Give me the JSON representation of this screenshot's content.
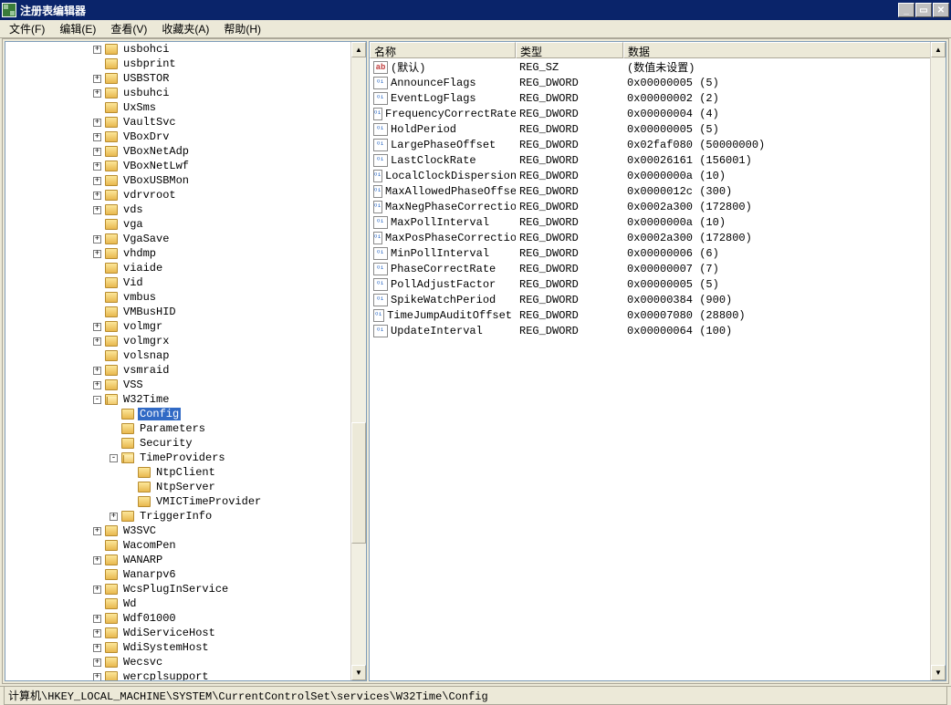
{
  "window": {
    "title": "注册表编辑器"
  },
  "menu": {
    "file": "文件(F)",
    "edit": "编辑(E)",
    "view": "查看(V)",
    "favorites": "收藏夹(A)",
    "help": "帮助(H)"
  },
  "tree": {
    "items": [
      {
        "indent": 5,
        "exp": "+",
        "label": "usbohci"
      },
      {
        "indent": 5,
        "exp": "",
        "label": "usbprint"
      },
      {
        "indent": 5,
        "exp": "+",
        "label": "USBSTOR"
      },
      {
        "indent": 5,
        "exp": "+",
        "label": "usbuhci"
      },
      {
        "indent": 5,
        "exp": "",
        "label": "UxSms"
      },
      {
        "indent": 5,
        "exp": "+",
        "label": "VaultSvc"
      },
      {
        "indent": 5,
        "exp": "+",
        "label": "VBoxDrv"
      },
      {
        "indent": 5,
        "exp": "+",
        "label": "VBoxNetAdp"
      },
      {
        "indent": 5,
        "exp": "+",
        "label": "VBoxNetLwf"
      },
      {
        "indent": 5,
        "exp": "+",
        "label": "VBoxUSBMon"
      },
      {
        "indent": 5,
        "exp": "+",
        "label": "vdrvroot"
      },
      {
        "indent": 5,
        "exp": "+",
        "label": "vds"
      },
      {
        "indent": 5,
        "exp": "",
        "label": "vga"
      },
      {
        "indent": 5,
        "exp": "+",
        "label": "VgaSave"
      },
      {
        "indent": 5,
        "exp": "+",
        "label": "vhdmp"
      },
      {
        "indent": 5,
        "exp": "",
        "label": "viaide"
      },
      {
        "indent": 5,
        "exp": "",
        "label": "Vid"
      },
      {
        "indent": 5,
        "exp": "",
        "label": "vmbus"
      },
      {
        "indent": 5,
        "exp": "",
        "label": "VMBusHID"
      },
      {
        "indent": 5,
        "exp": "+",
        "label": "volmgr"
      },
      {
        "indent": 5,
        "exp": "+",
        "label": "volmgrx"
      },
      {
        "indent": 5,
        "exp": "",
        "label": "volsnap"
      },
      {
        "indent": 5,
        "exp": "+",
        "label": "vsmraid"
      },
      {
        "indent": 5,
        "exp": "+",
        "label": "VSS"
      },
      {
        "indent": 5,
        "exp": "-",
        "label": "W32Time",
        "open": true
      },
      {
        "indent": 6,
        "exp": "",
        "label": "Config",
        "selected": true
      },
      {
        "indent": 6,
        "exp": "",
        "label": "Parameters"
      },
      {
        "indent": 6,
        "exp": "",
        "label": "Security"
      },
      {
        "indent": 6,
        "exp": "-",
        "label": "TimeProviders",
        "open": true
      },
      {
        "indent": 7,
        "exp": "",
        "label": "NtpClient"
      },
      {
        "indent": 7,
        "exp": "",
        "label": "NtpServer"
      },
      {
        "indent": 7,
        "exp": "",
        "label": "VMICTimeProvider"
      },
      {
        "indent": 6,
        "exp": "+",
        "label": "TriggerInfo"
      },
      {
        "indent": 5,
        "exp": "+",
        "label": "W3SVC"
      },
      {
        "indent": 5,
        "exp": "",
        "label": "WacomPen"
      },
      {
        "indent": 5,
        "exp": "+",
        "label": "WANARP"
      },
      {
        "indent": 5,
        "exp": "",
        "label": "Wanarpv6"
      },
      {
        "indent": 5,
        "exp": "+",
        "label": "WcsPlugInService"
      },
      {
        "indent": 5,
        "exp": "",
        "label": "Wd"
      },
      {
        "indent": 5,
        "exp": "+",
        "label": "Wdf01000"
      },
      {
        "indent": 5,
        "exp": "+",
        "label": "WdiServiceHost"
      },
      {
        "indent": 5,
        "exp": "+",
        "label": "WdiSystemHost"
      },
      {
        "indent": 5,
        "exp": "+",
        "label": "Wecsvc"
      },
      {
        "indent": 5,
        "exp": "+",
        "label": "wercplsupport"
      }
    ]
  },
  "list": {
    "headers": {
      "name": "名称",
      "type": "类型",
      "data": "数据"
    },
    "rows": [
      {
        "icon": "str",
        "name": "(默认)",
        "type": "REG_SZ",
        "data": "(数值未设置)"
      },
      {
        "icon": "dw",
        "name": "AnnounceFlags",
        "type": "REG_DWORD",
        "data": "0x00000005 (5)",
        "highlight": true
      },
      {
        "icon": "dw",
        "name": "EventLogFlags",
        "type": "REG_DWORD",
        "data": "0x00000002 (2)"
      },
      {
        "icon": "dw",
        "name": "FrequencyCorrectRate",
        "type": "REG_DWORD",
        "data": "0x00000004 (4)"
      },
      {
        "icon": "dw",
        "name": "HoldPeriod",
        "type": "REG_DWORD",
        "data": "0x00000005 (5)"
      },
      {
        "icon": "dw",
        "name": "LargePhaseOffset",
        "type": "REG_DWORD",
        "data": "0x02faf080 (50000000)"
      },
      {
        "icon": "dw",
        "name": "LastClockRate",
        "type": "REG_DWORD",
        "data": "0x00026161 (156001)"
      },
      {
        "icon": "dw",
        "name": "LocalClockDispersion",
        "type": "REG_DWORD",
        "data": "0x0000000a (10)"
      },
      {
        "icon": "dw",
        "name": "MaxAllowedPhaseOffset",
        "type": "REG_DWORD",
        "data": "0x0000012c (300)"
      },
      {
        "icon": "dw",
        "name": "MaxNegPhaseCorrection",
        "type": "REG_DWORD",
        "data": "0x0002a300 (172800)"
      },
      {
        "icon": "dw",
        "name": "MaxPollInterval",
        "type": "REG_DWORD",
        "data": "0x0000000a (10)"
      },
      {
        "icon": "dw",
        "name": "MaxPosPhaseCorrection",
        "type": "REG_DWORD",
        "data": "0x0002a300 (172800)"
      },
      {
        "icon": "dw",
        "name": "MinPollInterval",
        "type": "REG_DWORD",
        "data": "0x00000006 (6)"
      },
      {
        "icon": "dw",
        "name": "PhaseCorrectRate",
        "type": "REG_DWORD",
        "data": "0x00000007 (7)"
      },
      {
        "icon": "dw",
        "name": "PollAdjustFactor",
        "type": "REG_DWORD",
        "data": "0x00000005 (5)"
      },
      {
        "icon": "dw",
        "name": "SpikeWatchPeriod",
        "type": "REG_DWORD",
        "data": "0x00000384 (900)"
      },
      {
        "icon": "dw",
        "name": "TimeJumpAuditOffset",
        "type": "REG_DWORD",
        "data": "0x00007080 (28800)"
      },
      {
        "icon": "dw",
        "name": "UpdateInterval",
        "type": "REG_DWORD",
        "data": "0x00000064 (100)"
      }
    ]
  },
  "statusbar": {
    "path": "计算机\\HKEY_LOCAL_MACHINE\\SYSTEM\\CurrentControlSet\\services\\W32Time\\Config"
  },
  "icons": {
    "str_label": "ab",
    "dw_label": "011 110"
  },
  "scrollbar": {
    "up": "▲",
    "down": "▼"
  },
  "winbuttons": {
    "min": "_",
    "max": "▭",
    "close": "✕"
  }
}
